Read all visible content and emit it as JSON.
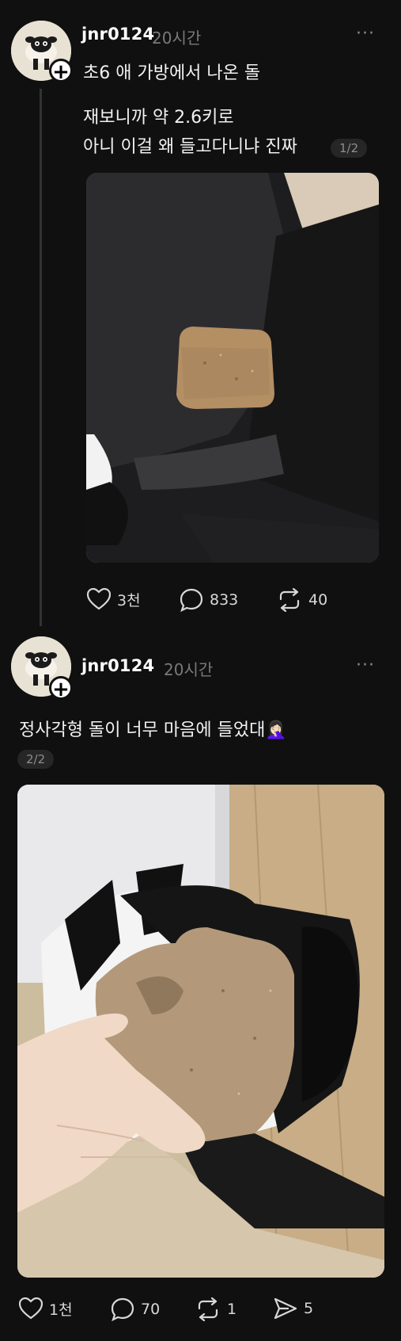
{
  "posts": [
    {
      "username": "jnr0124",
      "time": "20시간",
      "more": "···",
      "lines": [
        "초6 애 가방에서 나온 돌",
        "재보니까 약 2.6키로",
        "아니 이걸 왜 들고다니냐 진짜"
      ],
      "pager": "1/2",
      "actions": {
        "likes": "3천",
        "comments": "833",
        "reposts": "40"
      }
    },
    {
      "username": "jnr0124",
      "time": "20시간",
      "more": "···",
      "lines": [
        "정사각형 돌이 너무 마음에 들었대🤦🏻‍♀️"
      ],
      "pager": "2/2",
      "actions": {
        "likes": "1천",
        "comments": "70",
        "reposts": "1",
        "shares": "5"
      }
    }
  ],
  "icons": {
    "like": "heart-icon",
    "comment": "comment-bubble-icon",
    "repost": "repost-arrows-icon",
    "share": "send-arrow-icon",
    "follow": "plus-icon",
    "more": "more-dots-icon"
  },
  "colors": {
    "background": "#101010",
    "muted": "#7a7a7a",
    "text": "#f2f2f2"
  }
}
